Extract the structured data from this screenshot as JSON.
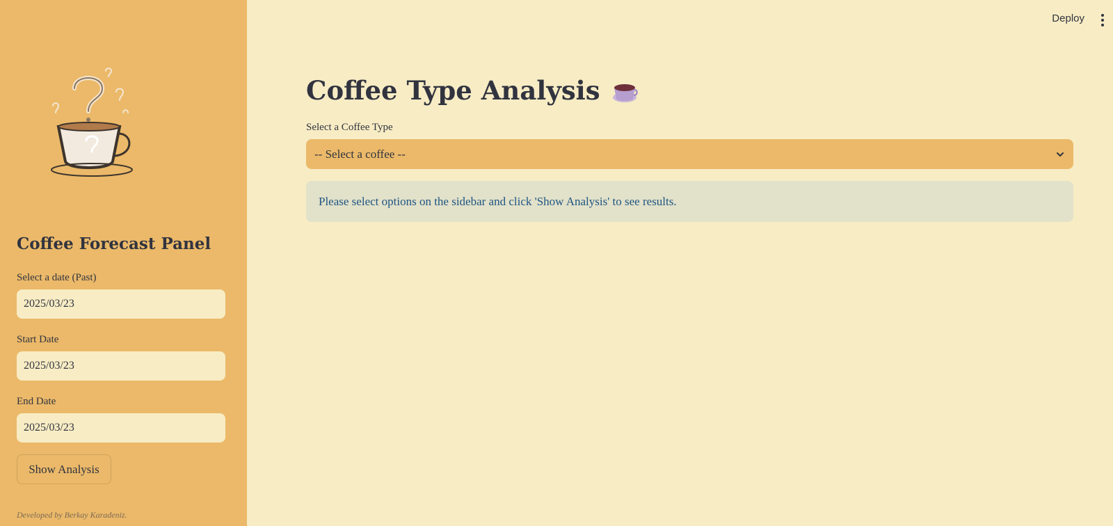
{
  "sidebar": {
    "panel_title": "Coffee Forecast Panel",
    "date_past_label": "Select a date (Past)",
    "date_past_value": "2025/03/23",
    "start_date_label": "Start Date",
    "start_date_value": "2025/03/23",
    "end_date_label": "End Date",
    "end_date_value": "2025/03/23",
    "show_button_label": "Show Analysis",
    "footer": "Developed by Berkay Karadeniz.",
    "logo_icon": "coffee-cup-question-icon"
  },
  "topbar": {
    "deploy_label": "Deploy",
    "menu_icon": "kebab-menu-icon"
  },
  "main": {
    "title": "Coffee Type Analysis",
    "title_icon": "coffee-cup-icon",
    "select_label": "Select a Coffee Type",
    "select_value": "-- Select a coffee --",
    "info_message": "Please select options on the sidebar and click 'Show Analysis' to see results."
  },
  "colors": {
    "sidebar_bg": "#ebb969",
    "main_bg": "#f7ecc4",
    "info_bg": "#e2e1c9",
    "info_text": "#1e5583",
    "text": "#31333f"
  }
}
